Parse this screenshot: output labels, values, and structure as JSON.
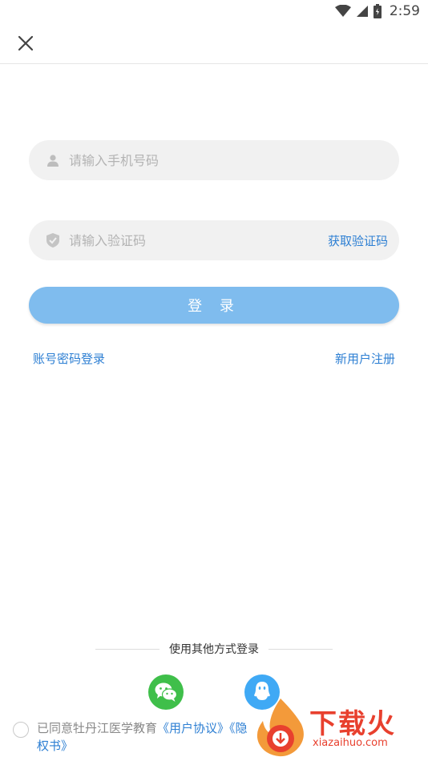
{
  "status_bar": {
    "time": "2:59"
  },
  "phone_field": {
    "placeholder": "请输入手机号码",
    "value": ""
  },
  "code_field": {
    "placeholder": "请输入验证码",
    "value": "",
    "get_code_label": "获取验证码"
  },
  "login_button_label": "登 录",
  "links": {
    "password_login": "账号密码登录",
    "register": "新用户注册"
  },
  "other_login_label": "使用其他方式登录",
  "social_icons": [
    "wechat-icon",
    "qq-icon"
  ],
  "agreement": {
    "prefix": "已同意牡丹江医学教育",
    "user_agreement": "《用户协议》",
    "privacy_partial": "《隐",
    "privacy_tail": "权书》"
  },
  "watermark": {
    "title": "下载火",
    "url": "xiazaihuo.com"
  },
  "colors": {
    "accent": "#2d7fd3",
    "login_button": "#7fbcee",
    "field_bg": "#f1f1f1",
    "wechat": "#3fbf4a",
    "qq": "#3fa9f5",
    "watermark": "#e8402e"
  }
}
